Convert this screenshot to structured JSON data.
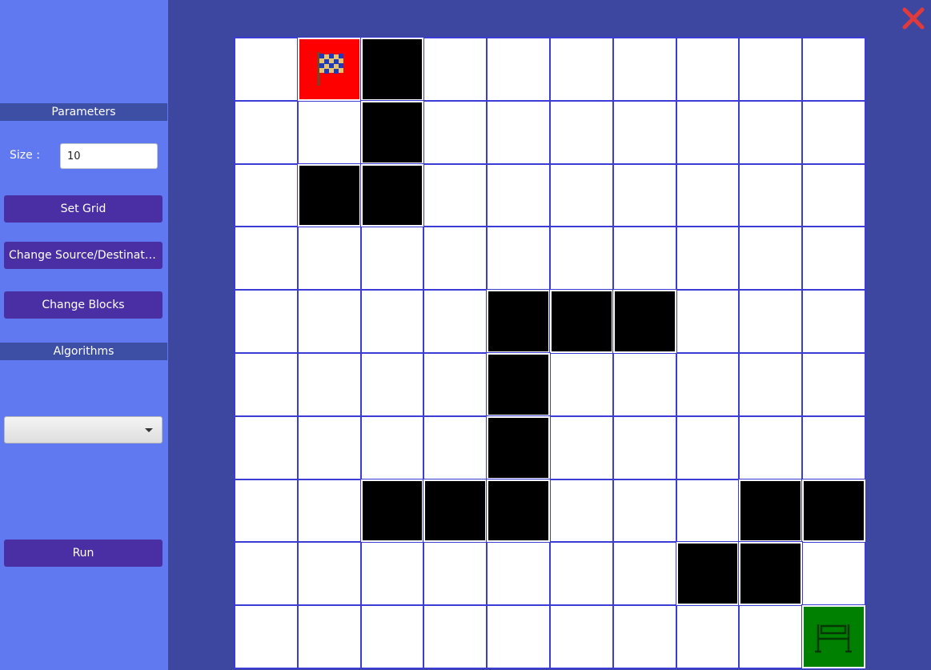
{
  "sidebar": {
    "parameters_header": "Parameters",
    "size_label": "Size :",
    "size_value": "10",
    "set_grid_label": "Set Grid",
    "change_source_label": "Change Source/Destinati...",
    "change_blocks_label": "Change Blocks",
    "algorithms_header": "Algorithms",
    "algorithm_selected": "",
    "run_label": "Run"
  },
  "grid": {
    "size": 10,
    "source": [
      0,
      1
    ],
    "destination": [
      9,
      9
    ],
    "blocks": [
      [
        0,
        2
      ],
      [
        1,
        2
      ],
      [
        2,
        1
      ],
      [
        2,
        2
      ],
      [
        4,
        4
      ],
      [
        4,
        5
      ],
      [
        4,
        6
      ],
      [
        5,
        4
      ],
      [
        6,
        4
      ],
      [
        7,
        2
      ],
      [
        7,
        3
      ],
      [
        7,
        4
      ],
      [
        7,
        8
      ],
      [
        7,
        9
      ],
      [
        8,
        7
      ],
      [
        8,
        8
      ]
    ]
  },
  "colors": {
    "sidebar_bg": "#6179f0",
    "main_bg": "#3d47a0",
    "button_bg": "#4a2ea3",
    "block": "#000000",
    "source": "#ff0000",
    "destination": "#008000",
    "grid_line": "#3b3bd6",
    "close_icon": "#e03a3a"
  },
  "icons": {
    "close": "close-icon",
    "source": "checkered-flag-icon",
    "destination": "finish-gate-icon"
  }
}
